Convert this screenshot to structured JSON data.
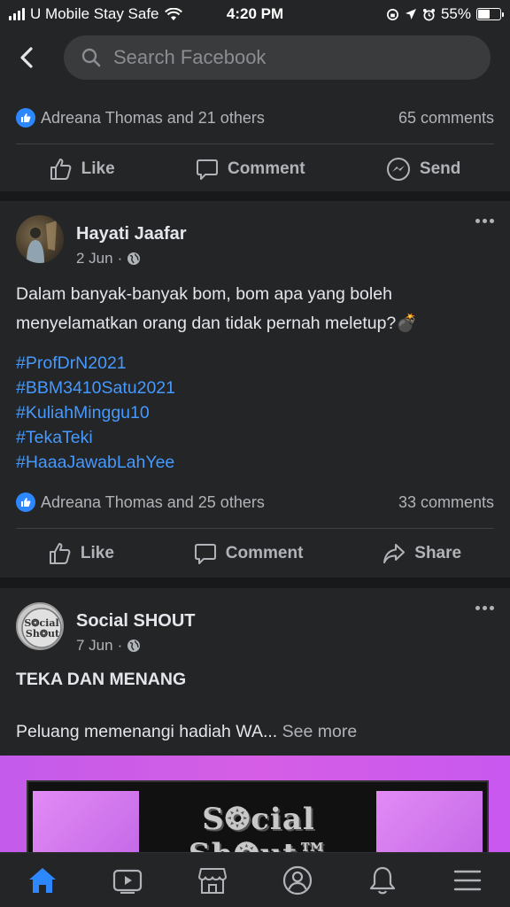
{
  "status_bar": {
    "carrier": "U Mobile Stay Safe",
    "time": "4:20 PM",
    "battery": "55%",
    "battery_level": 0.55
  },
  "search": {
    "placeholder": "Search Facebook"
  },
  "post_prev": {
    "reactions": "Adreana Thomas and 21 others",
    "comments": "65 comments",
    "actions": {
      "like": "Like",
      "comment": "Comment",
      "send": "Send"
    }
  },
  "post_hayati": {
    "author": "Hayati Jaafar",
    "date": "2 Jun",
    "text": "Dalam banyak-banyak bom, bom apa yang boleh menyelamatkan orang dan tidak pernah meletup?💣",
    "hashtags": [
      "#ProfDrN2021",
      "#BBM3410Satu2021",
      "#KuliahMinggu10",
      "#TekaTeki",
      "#HaaaJawabLahYee"
    ],
    "reactions": "Adreana Thomas and 25 others",
    "comments": "33 comments",
    "actions": {
      "like": "Like",
      "comment": "Comment",
      "share": "Share"
    }
  },
  "post_social": {
    "author": "Social SHOUT",
    "date": "7 Jun",
    "title": "TEKA DAN MENANG",
    "text": "Peluang memenangi hadiah WA...",
    "see_more": "See more",
    "image_logo": "S❂cial Sh❂ut™"
  },
  "colors": {
    "background": "#18191a",
    "card": "#242526",
    "link": "#4599ff",
    "accent": "#2d88ff"
  }
}
